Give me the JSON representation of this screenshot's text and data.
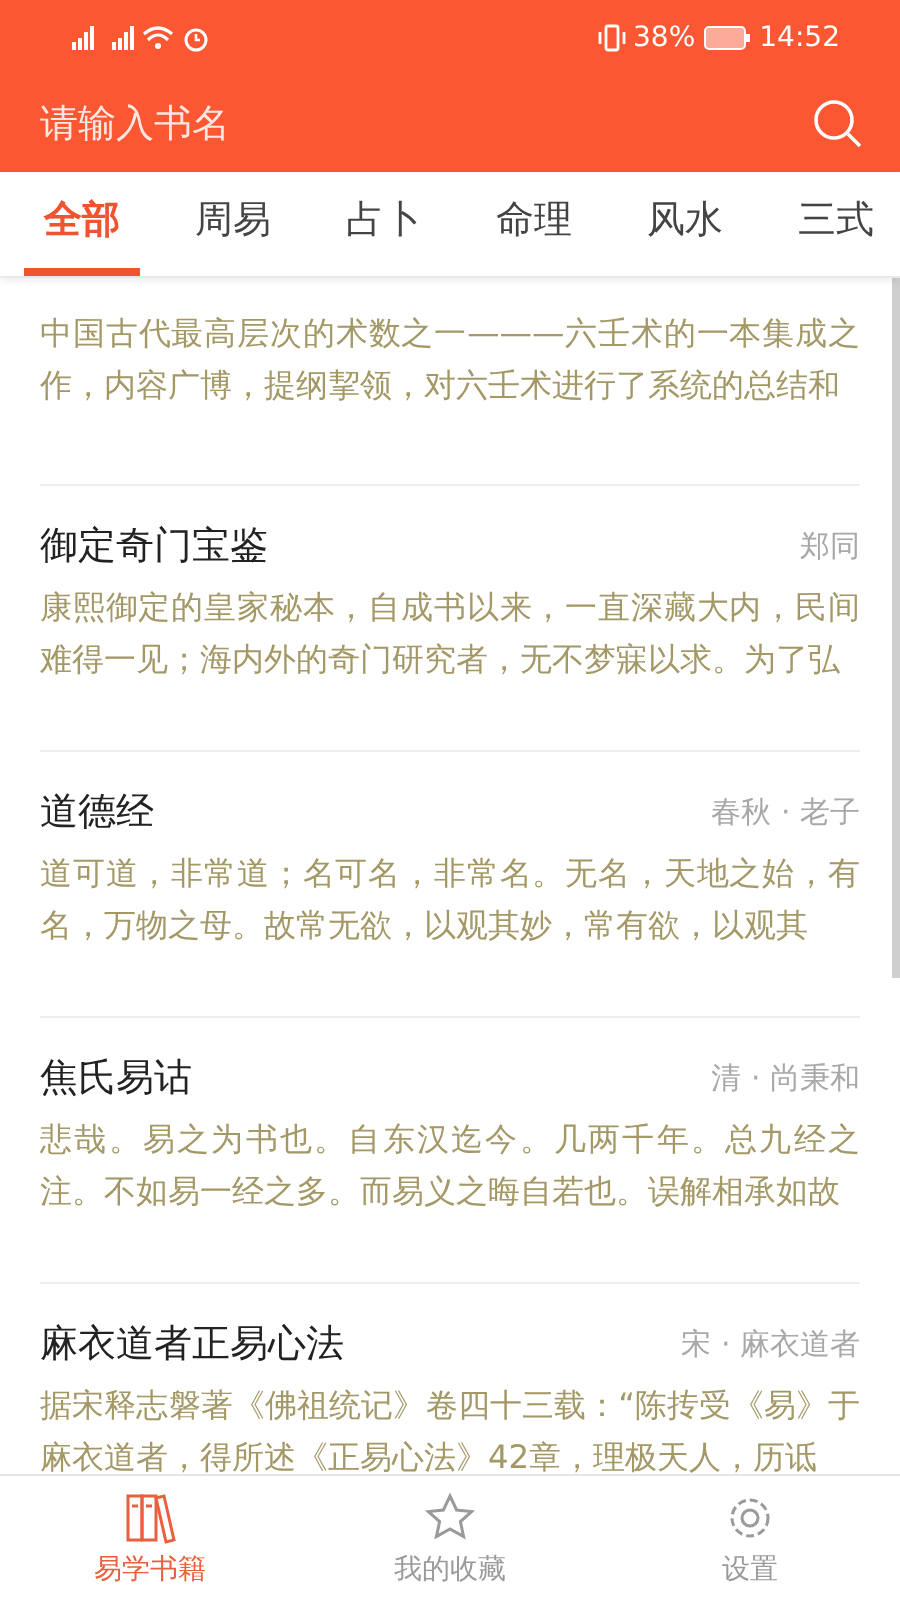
{
  "status_bar": {
    "battery": "38%",
    "time": "14:52"
  },
  "search": {
    "placeholder": "请输入书名"
  },
  "tabs": [
    {
      "label": "全部",
      "selected": true
    },
    {
      "label": "周易",
      "selected": false
    },
    {
      "label": "占卜",
      "selected": false
    },
    {
      "label": "命理",
      "selected": false
    },
    {
      "label": "风水",
      "selected": false
    },
    {
      "label": "三式",
      "selected": false
    }
  ],
  "books": [
    {
      "description": "中国古代最高层次的术数之一———六壬术的一本集成之作，内容广博，提纲挈领，对六壬术进行了系统的总结和"
    },
    {
      "title": "御定奇门宝鉴",
      "author": "郑同",
      "description": "康熙御定的皇家秘本，自成书以来，一直深藏大内，民间难得一见；海内外的奇门研究者，无不梦寐以求。为了弘"
    },
    {
      "title": "道德经",
      "author": "春秋 · 老子",
      "description": "道可道，非常道；名可名，非常名。无名，天地之始，有名，万物之母。故常无欲，以观其妙，常有欲，以观其"
    },
    {
      "title": "焦氏易诂",
      "author": "清 · 尚秉和",
      "description": "悲哉。易之为书也。自东汉迄今。几两千年。总九经之注。不如易一经之多。而易义之晦自若也。误解相承如故"
    },
    {
      "title": "麻衣道者正易心法",
      "author": "宋 · 麻衣道者",
      "description": "据宋释志磐著《佛祖统记》卷四十三载：“陈抟受《易》于麻衣道者，得所述《正易心法》42章，理极天人，历诋"
    }
  ],
  "nav": [
    {
      "kind": "books",
      "label": "易学书籍",
      "selected": true
    },
    {
      "kind": "star",
      "label": "我的收藏",
      "selected": false
    },
    {
      "kind": "gear",
      "label": "设置",
      "selected": false
    }
  ]
}
